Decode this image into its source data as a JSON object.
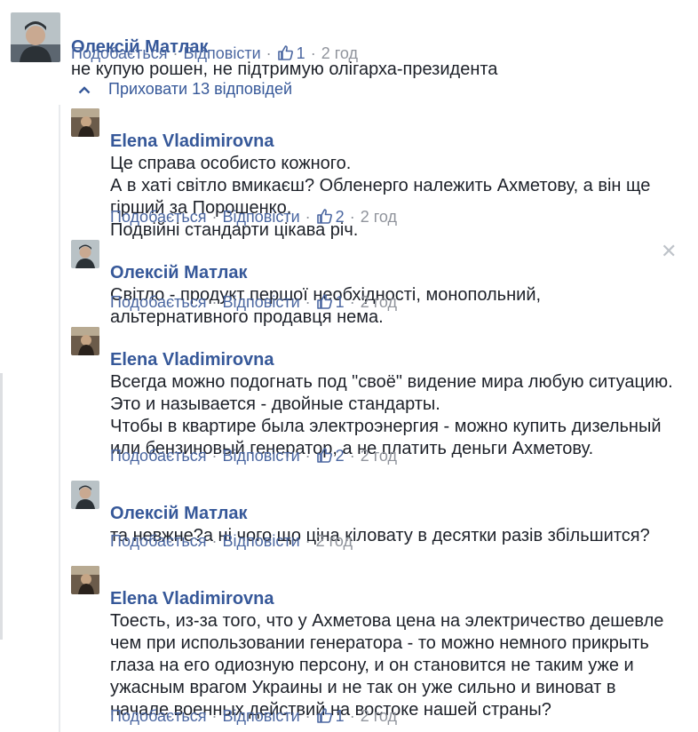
{
  "top_comment": {
    "author": "Олексій Матлак",
    "text": "не купую рошен, не підтримую олігарха-президента",
    "like_label": "Подобається",
    "reply_label": "Відповісти",
    "like_count": "1",
    "time": "2 год"
  },
  "replies_toggle": {
    "label": "Приховати 13 відповідей"
  },
  "replies": [
    {
      "author": "Elena Vladimirovna",
      "text": "Це справа особисто кожного.\nА в хаті світло вмикаєш? Обленерго належить Ахметову, а він ще гірший за Порошенко.\nПодвійні стандарти цікава річ.",
      "like_label": "Подобається",
      "reply_label": "Відповісти",
      "like_count": "2",
      "time": "2 год"
    },
    {
      "author": "Олексій Матлак",
      "text": "Світло - продукт першої необхідності, монопольний, альтернативного продавця нема.",
      "like_label": "Подобається",
      "reply_label": "Відповісти",
      "like_count": "1",
      "time": "2 год"
    },
    {
      "author": "Elena Vladimirovna",
      "text": "Всегда можно подогнать под \"своё\" видение мира любую ситуацию.\nЭто и называется - двойные стандарты.\nЧтобы в квартире была электроэнергия - можно купить дизельный или бензиновый генератор, а не платить деньги Ахметову.",
      "like_label": "Подобається",
      "reply_label": "Відповісти",
      "like_count": "2",
      "time": "2 год"
    },
    {
      "author": "Олексій Матлак",
      "text": "та невжне?а ні чого що ціна кіловату в десятки разів збільшится?",
      "like_label": "Подобається",
      "reply_label": "Відповісти",
      "time": "2 год"
    },
    {
      "author": "Elena Vladimirovna",
      "text": "Тоесть, из-за того, что у Ахметова цена на электричество дешевле чем при использовании генератора - то можно немного прикрыть глаза на его одиозную персону, и он становится не таким уже и ужасным врагом Украины и не так он уже сильно и виноват в начале военных действий на востоке нашей страны?",
      "like_label": "Подобається",
      "reply_label": "Відповісти",
      "like_count": "1",
      "time": "2 год"
    }
  ],
  "icons": {
    "like": "thumbs-up-icon",
    "toggle": "chevron-up-icon",
    "close": "close-icon"
  },
  "colors": {
    "name": "#365899",
    "link": "#4b67a1",
    "meta": "#90949c",
    "text": "#1d2129"
  }
}
